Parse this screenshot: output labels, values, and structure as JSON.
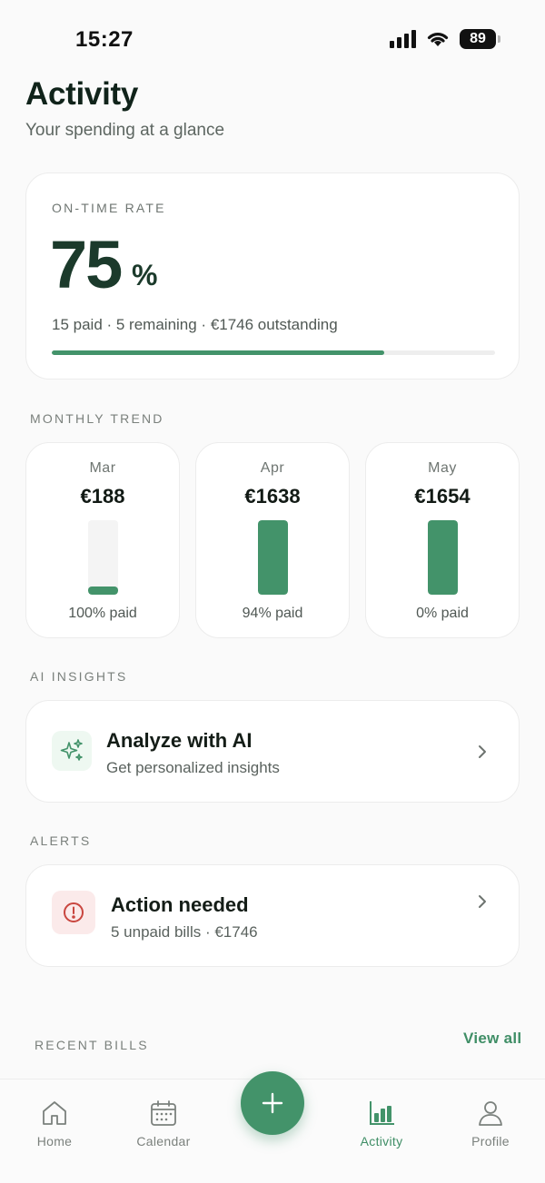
{
  "status_bar": {
    "time": "15:27",
    "battery": "89"
  },
  "header": {
    "title": "Activity",
    "subtitle": "Your spending at a glance"
  },
  "on_time": {
    "label": "ON-TIME RATE",
    "value": "75",
    "unit": "%",
    "summary": "15 paid · 5 remaining · €1746 outstanding",
    "progress_fraction": 0.75
  },
  "monthly_trend": {
    "label": "MONTHLY TREND",
    "months": [
      {
        "name": "Mar",
        "amount": "€188",
        "paid_text": "100% paid",
        "bar_fraction": 0.11
      },
      {
        "name": "Apr",
        "amount": "€1638",
        "paid_text": "94% paid",
        "bar_fraction": 1.0
      },
      {
        "name": "May",
        "amount": "€1654",
        "paid_text": "0% paid",
        "bar_fraction": 1.0
      }
    ]
  },
  "ai_insights": {
    "label": "AI INSIGHTS",
    "title": "Analyze with AI",
    "subtitle": "Get personalized insights",
    "icon": "sparkles-icon"
  },
  "alerts": {
    "label": "ALERTS",
    "title": "Action needed",
    "subtitle": "5 unpaid bills · €1746",
    "icon": "alert-circle-icon"
  },
  "recent_bills": {
    "label": "RECENT BILLS",
    "view_all": "View all"
  },
  "nav": {
    "items": [
      {
        "label": "Home",
        "icon": "home-icon"
      },
      {
        "label": "Calendar",
        "icon": "calendar-icon"
      },
      {
        "label": "Activity",
        "icon": "bar-chart-icon",
        "active": true
      },
      {
        "label": "Profile",
        "icon": "profile-icon"
      }
    ],
    "fab_icon": "plus-icon"
  },
  "colors": {
    "accent": "#43936a",
    "dark_green": "#1b3a2b",
    "alert_bg": "#fbeaea",
    "alert_red": "#c9463f",
    "ai_bg": "#eef8f1"
  }
}
